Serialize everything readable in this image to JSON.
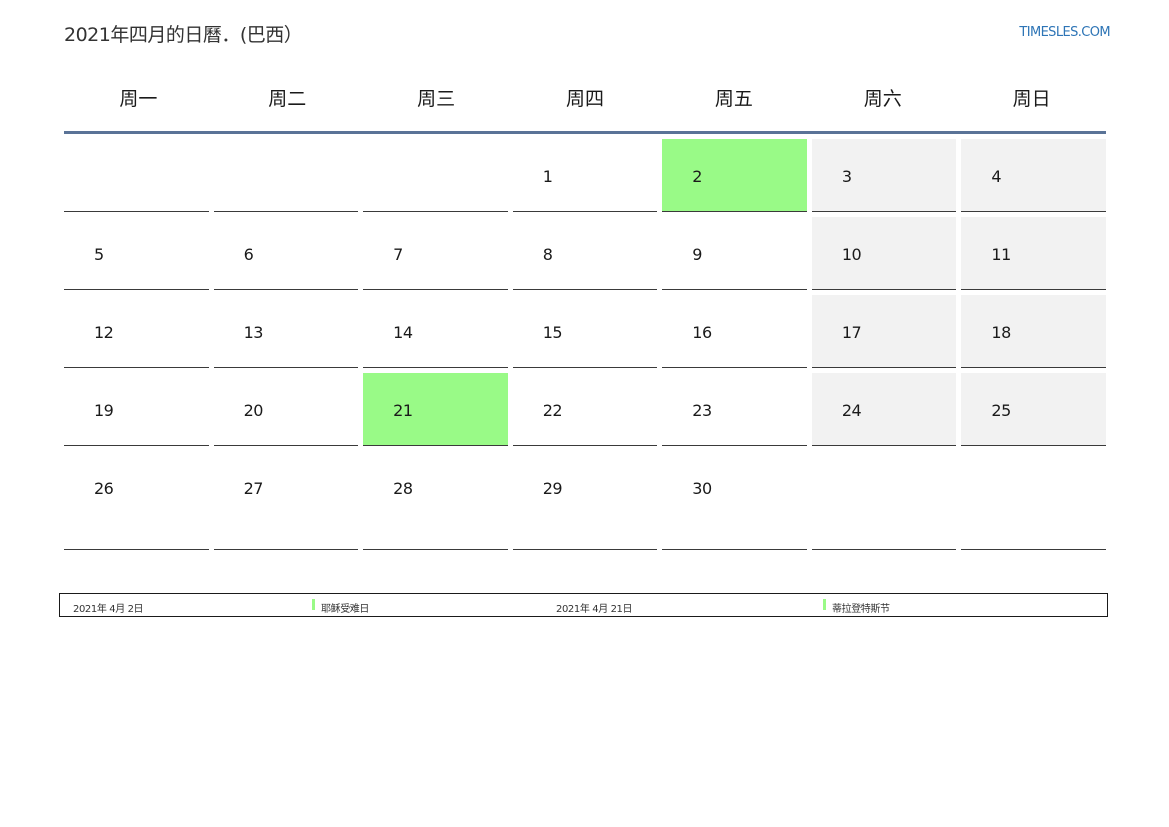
{
  "header": {
    "title": "2021年四月的日曆．(巴西）",
    "site": "TIMESLES.COM"
  },
  "weekdays": [
    "周一",
    "周二",
    "周三",
    "周四",
    "周五",
    "周六",
    "周日"
  ],
  "calendar": {
    "weeks": [
      [
        "",
        "",
        "",
        "1",
        "2",
        "3",
        "4"
      ],
      [
        "5",
        "6",
        "7",
        "8",
        "9",
        "10",
        "11"
      ],
      [
        "12",
        "13",
        "14",
        "15",
        "16",
        "17",
        "18"
      ],
      [
        "19",
        "20",
        "21",
        "22",
        "23",
        "24",
        "25"
      ],
      [
        "26",
        "27",
        "28",
        "29",
        "30",
        "",
        ""
      ]
    ],
    "holiday_days": [
      "2",
      "21"
    ],
    "holiday_color": "#99fa87",
    "weekend_color": "#f2f2f2"
  },
  "holidays": [
    {
      "date": "2021年 4月 2日",
      "name": "耶稣受难日"
    },
    {
      "date": "2021年 4月 21日",
      "name": "蒂拉登特斯节"
    }
  ]
}
